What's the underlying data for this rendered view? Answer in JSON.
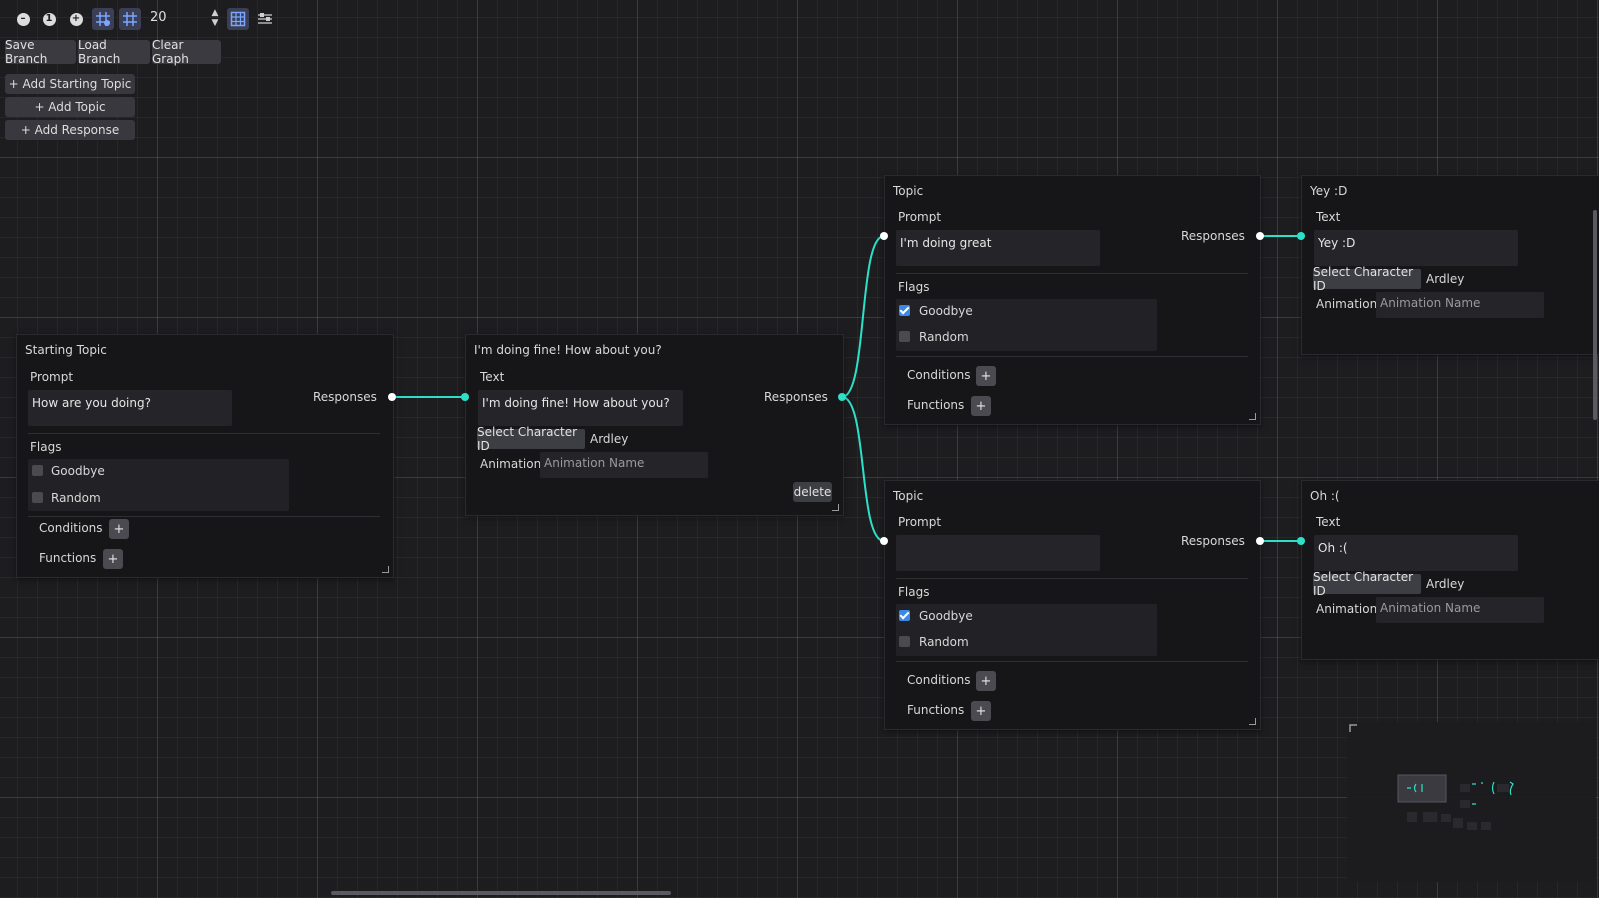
{
  "toolbar": {
    "zoom_value": "20",
    "buttons": [
      {
        "name": "zoom-out",
        "icon": "minus-circle-icon"
      },
      {
        "name": "zoom-reset",
        "icon": "one-circle-icon",
        "label": "1"
      },
      {
        "name": "zoom-in",
        "icon": "plus-circle-icon"
      },
      {
        "name": "snap-toggle",
        "icon": "grid-snap-icon"
      },
      {
        "name": "grid-toggle",
        "icon": "grid-icon"
      },
      {
        "name": "minimap-toggle",
        "icon": "map-grid-icon"
      },
      {
        "name": "arrange",
        "icon": "arrange-nodes-icon"
      }
    ],
    "save_branch": "Save Branch",
    "load_branch": "Load Branch",
    "clear_graph": "Clear Graph"
  },
  "side_actions": {
    "add_starting_topic": "+ Add Starting Topic",
    "add_topic": "+ Add Topic",
    "add_response": "+ Add Response"
  },
  "nodes": {
    "starting_topic": {
      "title": "Starting Topic",
      "prompt_label": "Prompt",
      "prompt_value": "How are you doing?",
      "responses_label": "Responses",
      "flags_label": "Flags",
      "flag_goodbye": "Goodbye",
      "flag_random": "Random",
      "goodbye_checked": false,
      "random_checked": false,
      "conditions_label": "Conditions",
      "functions_label": "Functions",
      "plus": "+"
    },
    "response_main": {
      "title": "I'm doing fine! How about you?",
      "text_label": "Text",
      "text_value": "I'm doing fine! How about you?",
      "responses_label": "Responses",
      "select_character": "Select Character ID",
      "character": "Ardley",
      "animation_label": "Animation",
      "animation_placeholder": "Animation Name",
      "delete": "delete"
    },
    "topic_1": {
      "title": "Topic",
      "prompt_label": "Prompt",
      "prompt_value": "I'm doing great",
      "responses_label": "Responses",
      "flags_label": "Flags",
      "flag_goodbye": "Goodbye",
      "flag_random": "Random",
      "goodbye_checked": true,
      "random_checked": false,
      "conditions_label": "Conditions",
      "functions_label": "Functions",
      "plus": "+"
    },
    "topic_2": {
      "title": "Topic",
      "prompt_label": "Prompt",
      "prompt_value": "",
      "responses_label": "Responses",
      "flags_label": "Flags",
      "flag_goodbye": "Goodbye",
      "flag_random": "Random",
      "goodbye_checked": true,
      "random_checked": false,
      "conditions_label": "Conditions",
      "functions_label": "Functions",
      "plus": "+"
    },
    "response_yey": {
      "title": "Yey :D",
      "text_label": "Text",
      "text_value": "Yey :D",
      "select_character": "Select Character ID",
      "character": "Ardley",
      "animation_label": "Animation",
      "animation_placeholder": "Animation Name"
    },
    "response_oh": {
      "title": "Oh :(",
      "text_label": "Text",
      "text_value": "Oh :(",
      "select_character": "Select Character ID",
      "character": "Ardley",
      "animation_label": "Animation",
      "animation_placeholder": "Animation Name"
    }
  },
  "colors": {
    "connection": "#2de0c8",
    "background": "#1d1d20",
    "node": "#161618",
    "checkbox_on": "#3b88e8"
  }
}
